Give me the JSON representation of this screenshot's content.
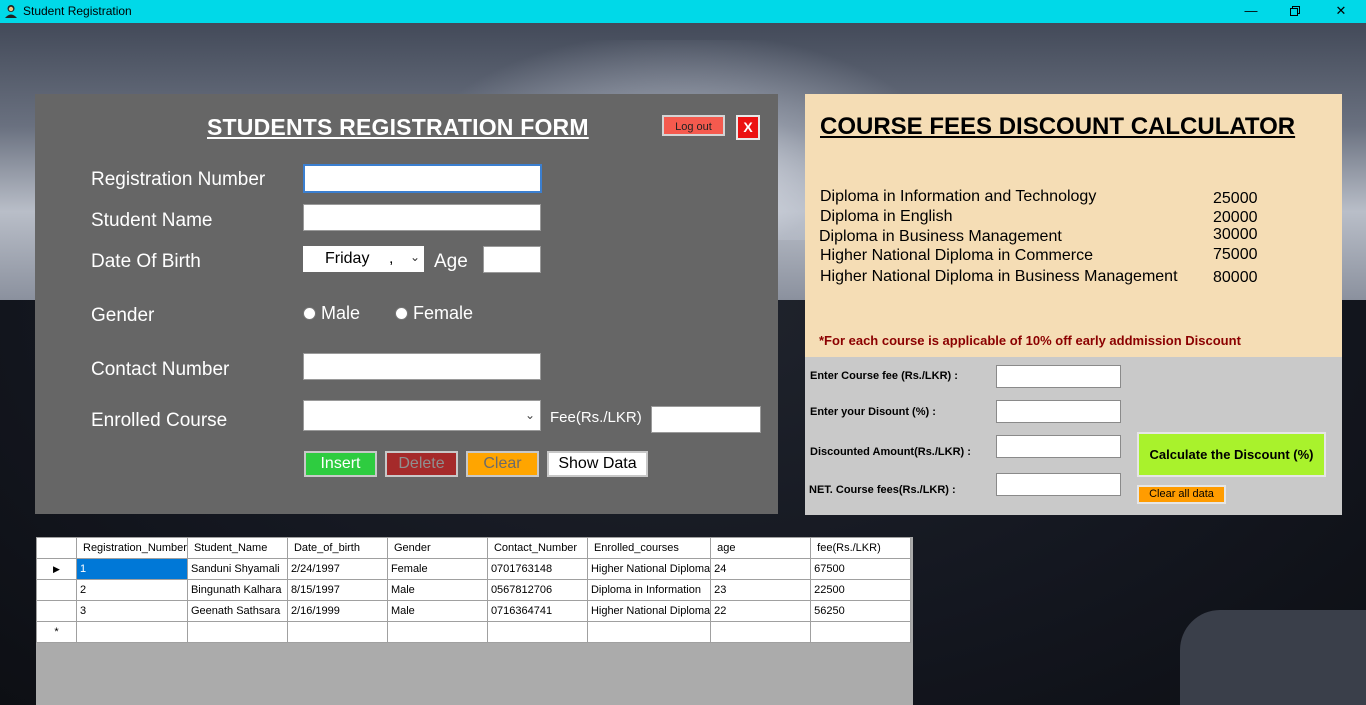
{
  "window": {
    "title": "Student Registration"
  },
  "registration": {
    "title": "STUDENTS REGISTRATION FORM",
    "logout_label": "Log out",
    "close_label": "X",
    "labels": {
      "reg_number": "Registration Number",
      "student_name": "Student Name",
      "dob": "Date Of Birth",
      "age": "Age",
      "gender": "Gender",
      "contact": "Contact Number",
      "course": "Enrolled Course",
      "fee": "Fee(Rs./LKR)"
    },
    "dob_value": "Friday",
    "dob_comma": ",",
    "gender_options": {
      "male": "Male",
      "female": "Female"
    },
    "buttons": {
      "insert": "Insert",
      "delete": "Delete",
      "clear": "Clear",
      "show": "Show Data"
    }
  },
  "calculator": {
    "title": "COURSE FEES DISCOUNT CALCULATOR",
    "courses": [
      {
        "name": "Diploma in Information and Technology",
        "fee": "25000"
      },
      {
        "name": "Diploma in English",
        "fee": "20000"
      },
      {
        "name": "Diploma in Business Management",
        "fee": "30000"
      },
      {
        "name": "Higher National Diploma in Commerce",
        "fee": "75000"
      },
      {
        "name": "Higher National Diploma in Business Management",
        "fee": "80000"
      }
    ],
    "note": "*For each course is applicable of 10% off early addmission Discount",
    "labels": {
      "course_fee": "Enter Course fee (Rs./LKR) :",
      "discount": "Enter your Disount (%) :",
      "discounted_amount": "Discounted Amount(Rs./LKR) :",
      "net_fee": "NET. Course fees(Rs./LKR) :"
    },
    "calculate_label": "Calculate the Discount (%)",
    "clear_label": "Clear all data"
  },
  "grid": {
    "columns": [
      "Registration_Number",
      "Student_Name",
      "Date_of_birth",
      "Gender",
      "Contact_Number",
      "Enrolled_courses",
      "age",
      "fee(Rs./LKR)"
    ],
    "rows": [
      [
        "1",
        "Sanduni Shyamali",
        "2/24/1997",
        "Female",
        "0701763148",
        "Higher National Diploma",
        "24",
        "67500"
      ],
      [
        "2",
        "Bingunath Kalhara",
        "8/15/1997",
        "Male",
        "0567812706",
        "Diploma in Information",
        "23",
        "22500"
      ],
      [
        "3",
        "Geenath Sathsara",
        "2/16/1999",
        "Male",
        "0716364741",
        "Higher National Diploma",
        "22",
        "56250"
      ]
    ],
    "new_row_marker": "*",
    "current_row_marker": "▶"
  },
  "colors": {
    "titlebar": "#00d9e8",
    "panel": "#666666",
    "calc_top": "#f5ddb5",
    "insert": "#2ecc40",
    "delete": "#a52a2a",
    "clear": "#ffa500",
    "calculate": "#a9f22c"
  }
}
